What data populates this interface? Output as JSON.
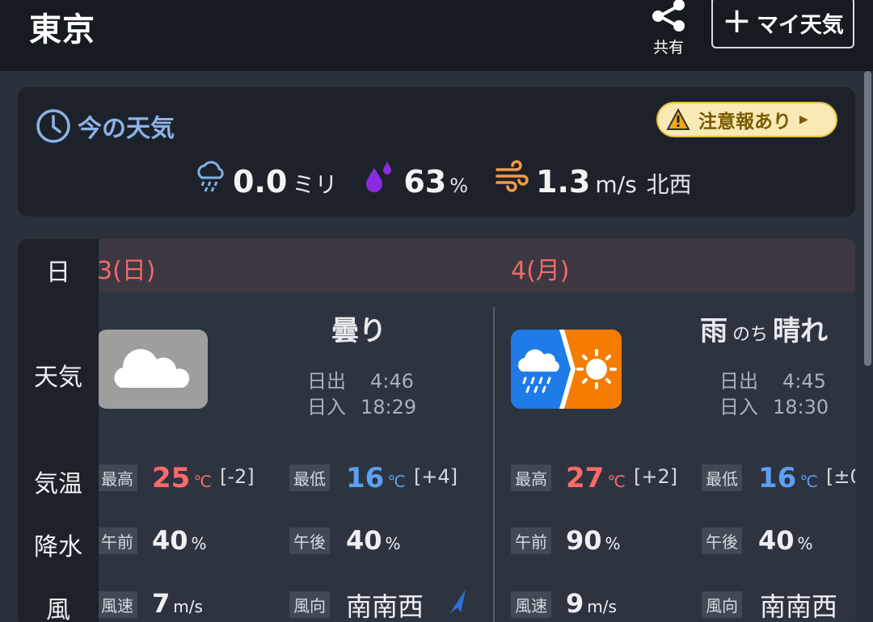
{
  "header": {
    "city": "東京",
    "share_label": "共有",
    "my_weather_label": "マイ天気"
  },
  "now": {
    "title": "今の天気",
    "alert_label": "注意報あり",
    "precip_value": "0.0",
    "precip_unit": "ミリ",
    "humidity_value": "63",
    "humidity_unit": "%",
    "wind_value": "1.3",
    "wind_unit": "m/s",
    "wind_dir": "北西"
  },
  "forecast": {
    "row_labels": {
      "day": "日",
      "weather": "天気",
      "temp": "気温",
      "precip": "降水",
      "wind": "風"
    },
    "days": [
      {
        "date": "3(日)",
        "weather_main": "曇り",
        "weather_mid": "",
        "weather_end": "",
        "sunrise_label": "日出",
        "sunrise": "4:46",
        "sunset_label": "日入",
        "sunset": "18:29",
        "max_label": "最高",
        "max_temp": "25",
        "max_diff": "[-2]",
        "min_label": "最低",
        "min_temp": "16",
        "min_diff": "[+4]",
        "temp_unit": "℃",
        "am_label": "午前",
        "am_precip": "40",
        "pm_label": "午後",
        "pm_precip": "40",
        "precip_unit": "%",
        "wind_speed_label": "風速",
        "wind_speed": "7",
        "wind_speed_unit": "m/s",
        "wind_dir_label": "風向",
        "wind_dir": "南南西"
      },
      {
        "date": "4(月)",
        "weather_main": "雨",
        "weather_mid": "のち",
        "weather_end": "晴れ",
        "sunrise_label": "日出",
        "sunrise": "4:45",
        "sunset_label": "日入",
        "sunset": "18:30",
        "max_label": "最高",
        "max_temp": "27",
        "max_diff": "[+2]",
        "min_label": "最低",
        "min_temp": "16",
        "min_diff": "[±0",
        "temp_unit": "℃",
        "am_label": "午前",
        "am_precip": "90",
        "pm_label": "午後",
        "pm_precip": "40",
        "precip_unit": "%",
        "wind_speed_label": "風速",
        "wind_speed": "9",
        "wind_speed_unit": "m/s",
        "wind_dir_label": "風向",
        "wind_dir": "南南西"
      }
    ]
  },
  "colors": {
    "accent_blue": "#8cb3e8",
    "max_red": "#ff6a6a",
    "min_blue": "#5c9ff3",
    "alert_bg": "#f8e9b5",
    "humidity_purple": "#8a2be2",
    "wind_orange": "#f2994a"
  },
  "icons": {
    "share": "share-icon",
    "plus": "plus-icon",
    "clock": "clock-icon",
    "warning": "warning-icon",
    "rain": "rain-icon",
    "humidity": "droplets-icon",
    "wind": "wind-icon",
    "cloudy": "cloud-icon",
    "rain_then_sun": "rain-then-sun-icon",
    "wind_direction": "wind-direction-arrow-icon"
  }
}
